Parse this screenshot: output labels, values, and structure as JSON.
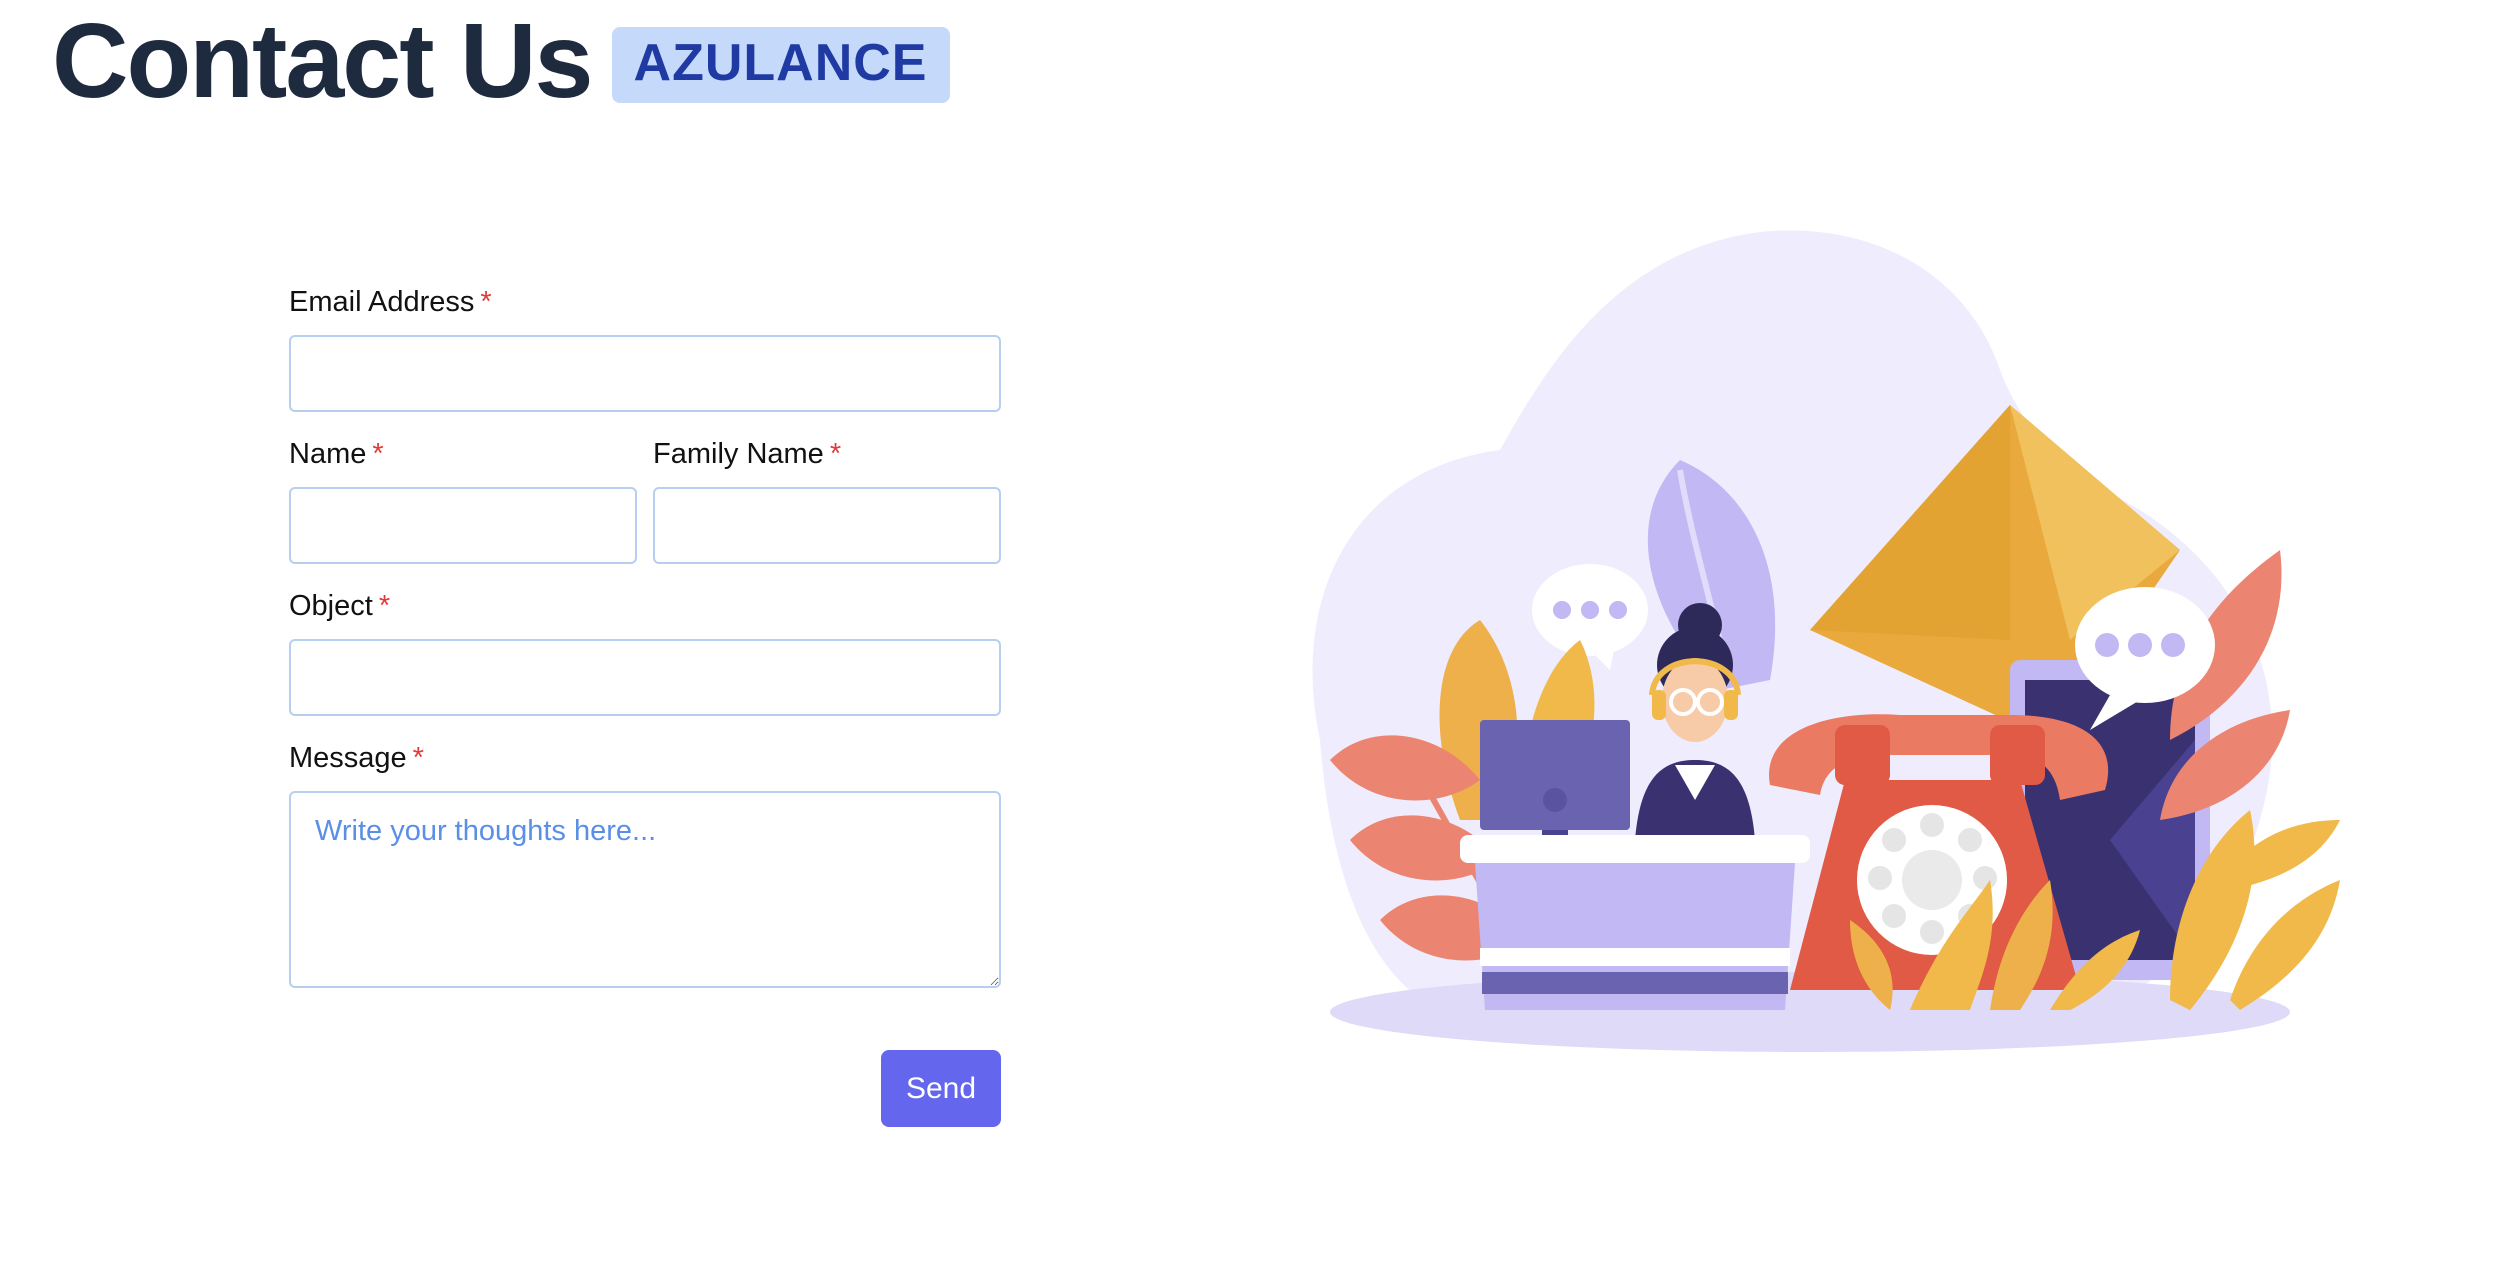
{
  "header": {
    "title": "Contact Us",
    "brand": "AZULANCE"
  },
  "form": {
    "email_label": "Email Address",
    "name_label": "Name",
    "family_name_label": "Family Name",
    "object_label": "Object",
    "message_label": "Message",
    "required_mark": "*",
    "message_placeholder": "Write your thoughts here...",
    "send_label": "Send"
  },
  "illustration": {
    "icon": "customer-support-illustration",
    "colors": {
      "blob": "#efedfd",
      "purple": "#6a63b0",
      "lavender": "#c2b8f3",
      "red": "#e05a45",
      "orange": "#eb7a62",
      "yellow": "#f0b94a",
      "navy": "#3a3270"
    }
  }
}
